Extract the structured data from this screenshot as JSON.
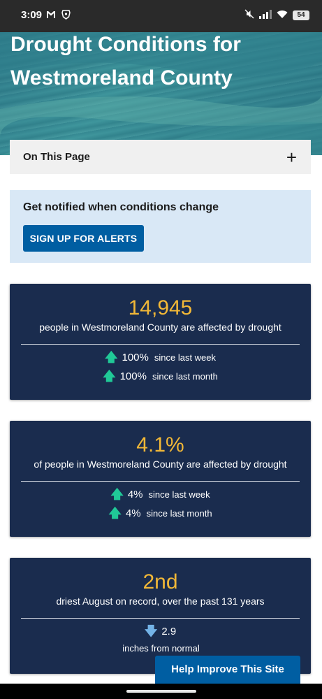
{
  "status_bar": {
    "time": "3:09",
    "left_icons": [
      "gmail-icon",
      "brave-icon"
    ],
    "right_icons": [
      "mute-icon",
      "signal-icon",
      "wifi-icon"
    ],
    "battery": "54"
  },
  "hero": {
    "title": "Drought Conditions for Westmoreland County"
  },
  "on_this_page": {
    "label": "On This Page",
    "icon": "plus-icon"
  },
  "alerts": {
    "title": "Get notified when conditions change",
    "button_label": "SIGN UP FOR ALERTS"
  },
  "cards": [
    {
      "value": "14,945",
      "description": "people in Westmoreland County are affected by drought",
      "rows": [
        {
          "icon": "arrow-up-icon",
          "value": "100%",
          "label": "since last week"
        },
        {
          "icon": "arrow-up-icon",
          "value": "100%",
          "label": "since last month"
        }
      ]
    },
    {
      "value": "4.1%",
      "description": "of people in Westmoreland County are affected by drought",
      "rows": [
        {
          "icon": "arrow-up-icon",
          "value": "4%",
          "label": "since last week"
        },
        {
          "icon": "arrow-up-icon",
          "value": "4%",
          "label": "since last month"
        }
      ]
    },
    {
      "value": "2nd",
      "description": "driest August on record, over the past 131 years",
      "rows": [
        {
          "icon": "arrow-down-icon",
          "value": "2.9",
          "label": ""
        }
      ],
      "footnote": "inches from normal"
    }
  ],
  "help_button": {
    "label": "Help Improve This Site"
  },
  "colors": {
    "card_bg": "#1a2c4e",
    "value_gold": "#f2b837",
    "arrow_up": "#20c997",
    "arrow_down": "#73b3e7",
    "primary_button": "#005ea2",
    "alert_bg": "#d9e8f6"
  }
}
